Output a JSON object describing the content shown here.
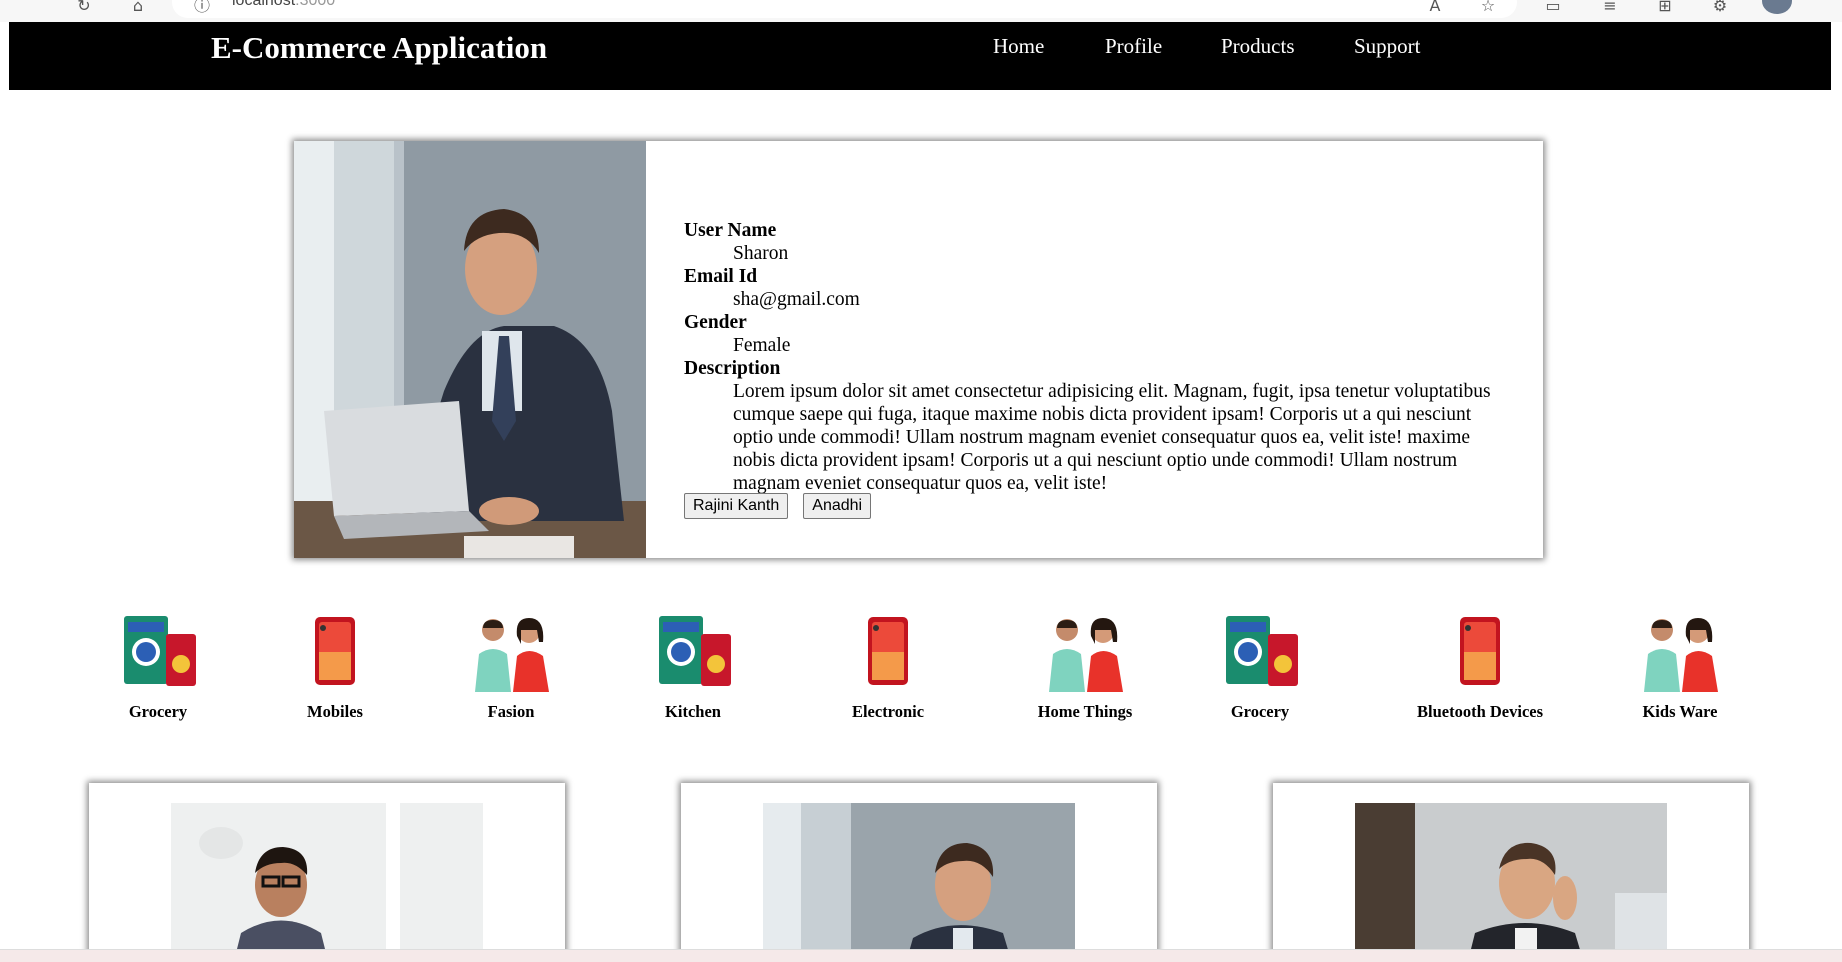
{
  "browser": {
    "url_host": "localhost",
    "url_port": ":3000"
  },
  "navbar": {
    "brand": "E-Commerce Application",
    "links": [
      "Home",
      "Profile",
      "Products",
      "Support"
    ]
  },
  "profile": {
    "fields": [
      {
        "label": "User Name",
        "value": "Sharon"
      },
      {
        "label": "Email Id",
        "value": "sha@gmail.com"
      },
      {
        "label": "Gender",
        "value": "Female"
      },
      {
        "label": "Description",
        "value": "Lorem ipsum dolor sit amet consectetur adipisicing elit. Magnam, fugit, ipsa tenetur voluptatibus cumque saepe qui fuga, itaque maxime nobis dicta provident ipsam! Corporis ut a qui nesciunt optio unde commodi! Ullam nostrum magnam eveniet consequatur quos ea, velit iste! maxime nobis dicta provident ipsam! Corporis ut a qui nesciunt optio unde commodi! Ullam nostrum magnam eveniet consequatur quos ea, velit iste!"
      }
    ],
    "buttons": [
      "Rajini Kanth",
      "Anadhi"
    ]
  },
  "categories": [
    "Grocery",
    "Mobiles",
    "Fasion",
    "Kitchen",
    "Electronic",
    "Home Things",
    "Grocery",
    "Bluetooth Devices",
    "Kids Ware"
  ],
  "colors": {
    "navbar_bg": "#000000",
    "phone_red": "#d9262b",
    "grocery_teal": "#1a8c6e"
  }
}
